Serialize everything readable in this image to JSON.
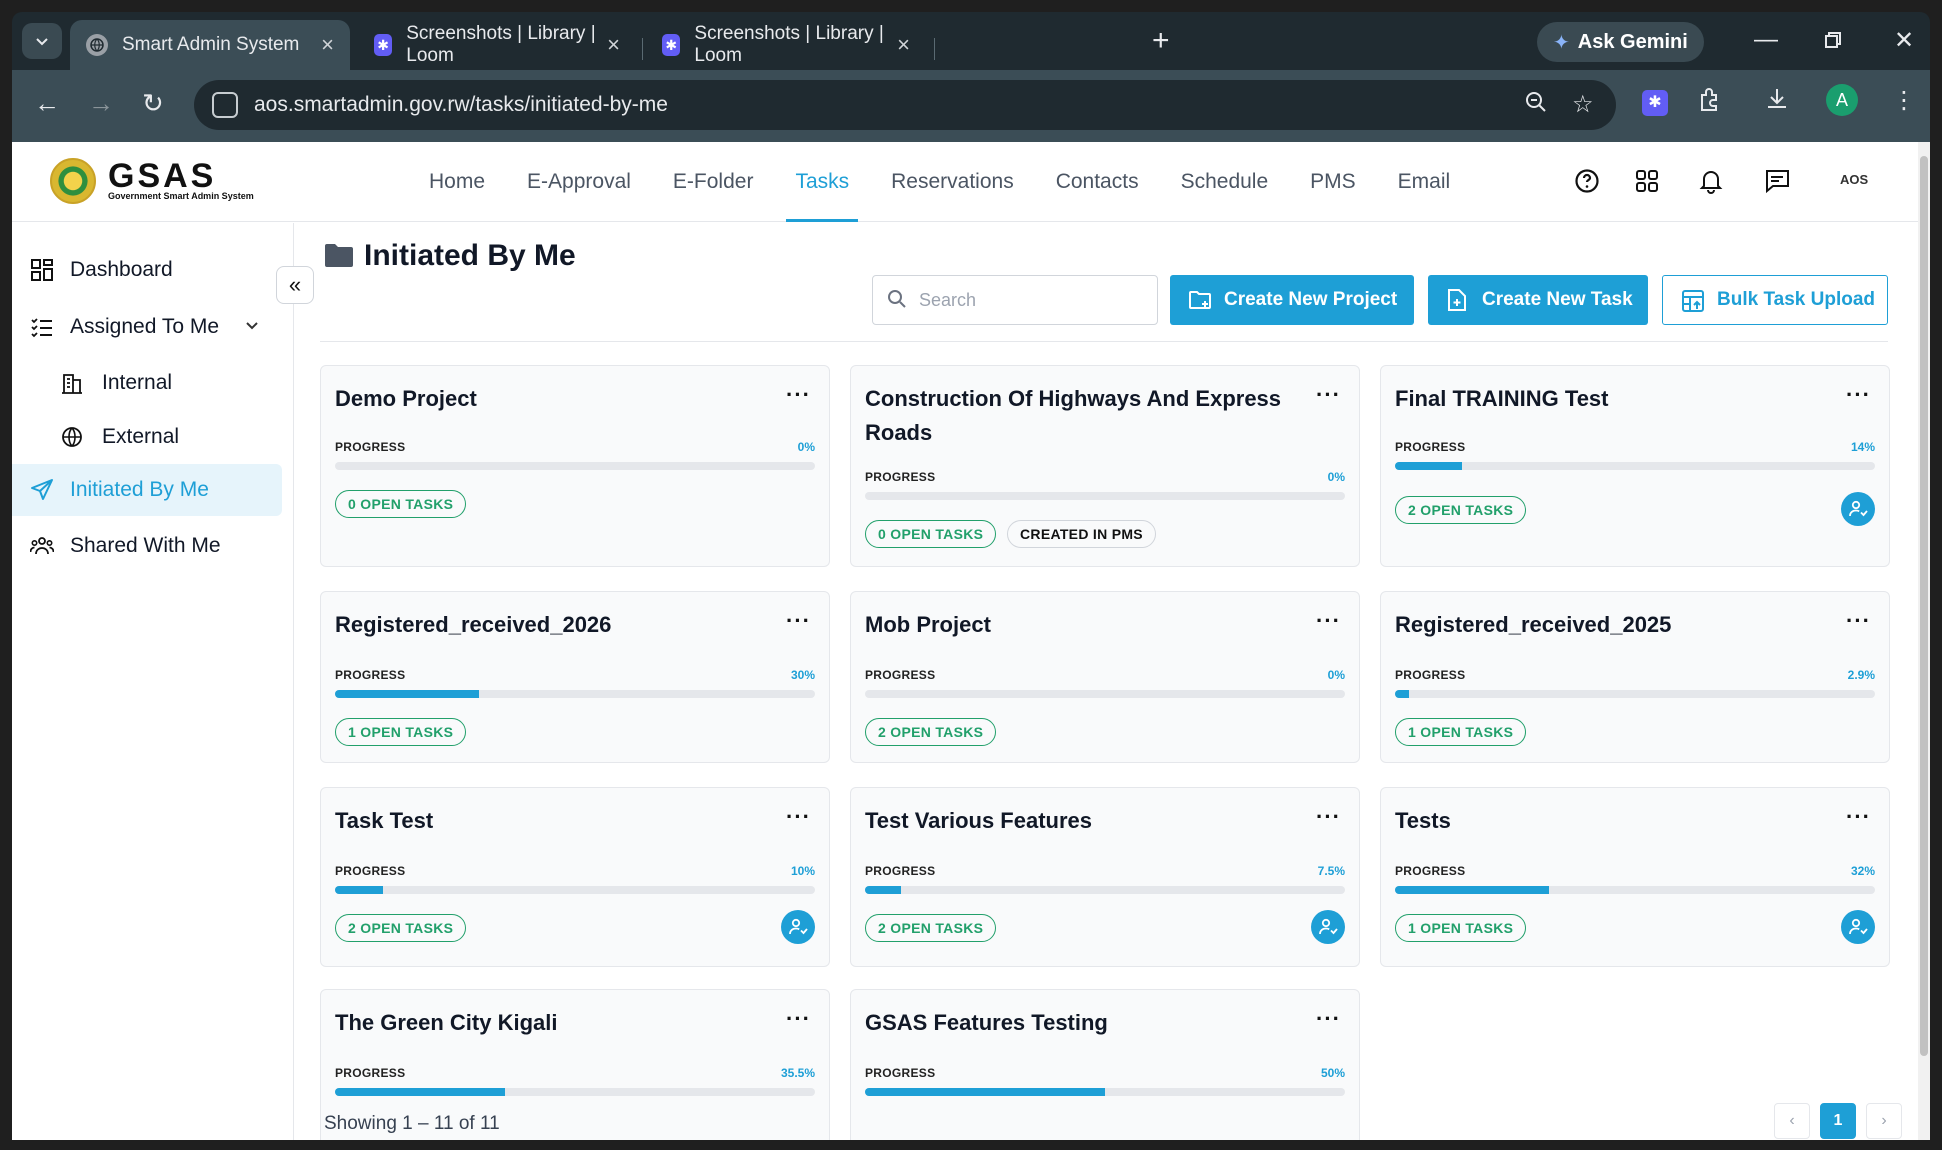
{
  "browser": {
    "tabs": [
      {
        "title": "Smart Admin System",
        "active": true
      },
      {
        "title": "Screenshots | Library | Loom",
        "active": false
      },
      {
        "title": "Screenshots | Library | Loom",
        "active": false
      }
    ],
    "gemini_label": "Ask Gemini",
    "url": "aos.smartadmin.gov.rw/tasks/initiated-by-me",
    "profile_initial": "A"
  },
  "app": {
    "logo_main": "GSAS",
    "logo_sub": "Government Smart Admin System",
    "nav": [
      "Home",
      "E-Approval",
      "E-Folder",
      "Tasks",
      "Reservations",
      "Contacts",
      "Schedule",
      "PMS",
      "Email"
    ],
    "nav_active": "Tasks",
    "header_badge": "AOS"
  },
  "sidebar": {
    "items": [
      {
        "label": "Dashboard",
        "icon": "grid-icon"
      },
      {
        "label": "Assigned To Me",
        "icon": "list-check-icon"
      },
      {
        "label": "Internal",
        "icon": "building-icon"
      },
      {
        "label": "External",
        "icon": "globe-icon"
      },
      {
        "label": "Initiated By Me",
        "icon": "send-icon"
      },
      {
        "label": "Shared With Me",
        "icon": "users-icon"
      }
    ]
  },
  "main": {
    "title": "Initiated By Me",
    "search_placeholder": "Search",
    "buttons": {
      "create_project": "Create New Project",
      "create_task": "Create New Task",
      "bulk_upload": "Bulk Task Upload"
    },
    "progress_label": "PROGRESS",
    "projects": [
      {
        "title": "Demo Project",
        "progress_text": "0%",
        "progress": 0,
        "open_tasks": "0 OPEN TASKS",
        "assignee": false
      },
      {
        "title": "Construction Of Highways And Express Roads",
        "progress_text": "0%",
        "progress": 0,
        "open_tasks": "0 OPEN TASKS",
        "tag": "CREATED IN PMS",
        "assignee": false
      },
      {
        "title": "Final TRAINING Test",
        "progress_text": "14%",
        "progress": 14,
        "open_tasks": "2 OPEN TASKS",
        "assignee": true
      },
      {
        "title": "Registered_received_2026",
        "progress_text": "30%",
        "progress": 30,
        "open_tasks": "1 OPEN TASKS",
        "assignee": false
      },
      {
        "title": "Mob Project",
        "progress_text": "0%",
        "progress": 0,
        "open_tasks": "2 OPEN TASKS",
        "assignee": false
      },
      {
        "title": "Registered_received_2025",
        "progress_text": "2.9%",
        "progress": 2.9,
        "open_tasks": "1 OPEN TASKS",
        "assignee": false
      },
      {
        "title": "Task Test",
        "progress_text": "10%",
        "progress": 10,
        "open_tasks": "2 OPEN TASKS",
        "assignee": true
      },
      {
        "title": "Test Various Features",
        "progress_text": "7.5%",
        "progress": 7.5,
        "open_tasks": "2 OPEN TASKS",
        "assignee": true
      },
      {
        "title": "Tests",
        "progress_text": "32%",
        "progress": 32,
        "open_tasks": "1 OPEN TASKS",
        "assignee": true
      },
      {
        "title": "The Green City Kigali",
        "progress_text": "35.5%",
        "progress": 35.5,
        "open_tasks": "",
        "assignee": false
      },
      {
        "title": "GSAS Features Testing",
        "progress_text": "50%",
        "progress": 50,
        "open_tasks": "",
        "assignee": false
      }
    ],
    "footer": "Showing 1 – 11 of 11",
    "page_current": "1",
    "pager_prev": "‹",
    "pager_next": "›"
  },
  "colors": {
    "accent": "#1e9fd6",
    "success": "#22a06b"
  }
}
